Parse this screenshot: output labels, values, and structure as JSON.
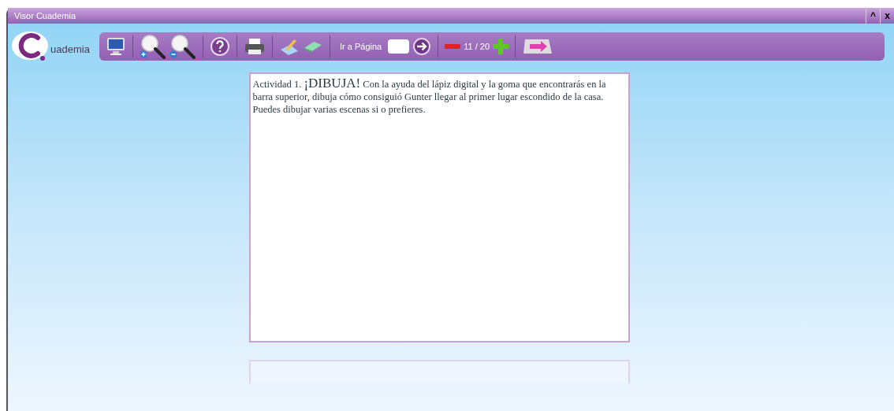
{
  "window": {
    "title": "Visor Cuademia",
    "controls": [
      "^",
      "x"
    ]
  },
  "logo": {
    "text": "uademia"
  },
  "toolbar": {
    "goto_label": "Ir a Página",
    "page_counter": "11 / 20"
  },
  "activity": {
    "prefix": "Actividad 1.",
    "heading": "¡DIBUJA!",
    "body": "Con la ayuda del lápiz digital y la goma que encontrarás en la barra superior, dibuja cómo consiguió Gunter llegar al primer lugar escondido de la casa. Puedes dibujar varias escenas si o prefieres."
  }
}
